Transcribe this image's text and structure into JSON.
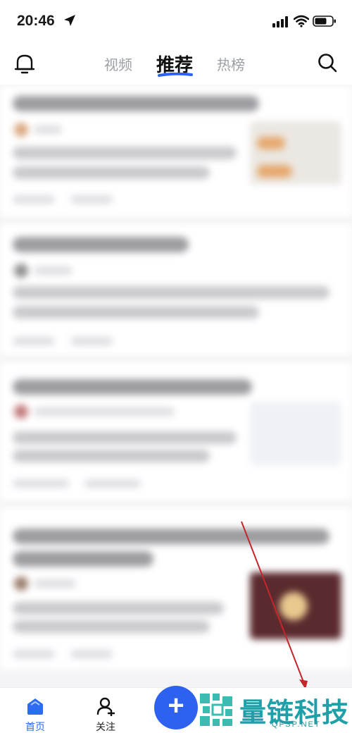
{
  "status_bar": {
    "time": "20:46"
  },
  "top_nav": {
    "tabs": [
      {
        "label": "视频"
      },
      {
        "label": "推荐"
      },
      {
        "label": "热榜"
      }
    ],
    "active_tab": "推荐",
    "accent_color": "#2c62ef"
  },
  "bottom_nav": {
    "home_label": "首页",
    "follow_label": "关注",
    "plus_label": "+"
  },
  "watermark": {
    "title": "量链科技",
    "subtitle": "QFSP.NET"
  }
}
